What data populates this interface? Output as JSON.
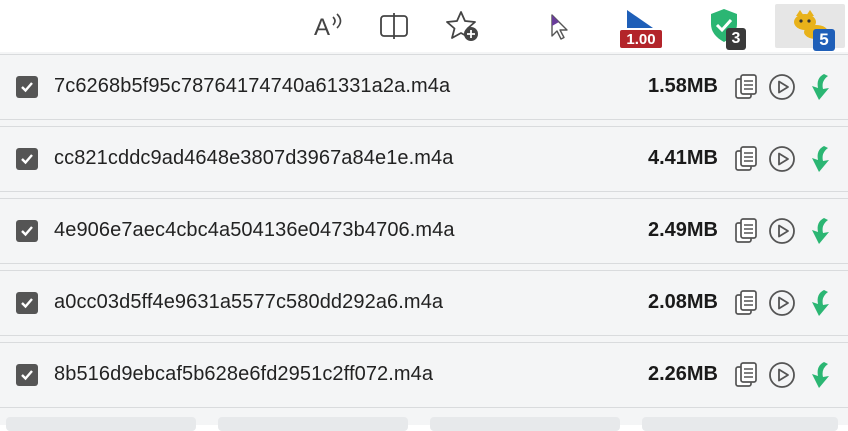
{
  "toolbar": {
    "read_aloud_label": "A",
    "ext_zoom_badge": "1.00",
    "ext_shield_badge": "3",
    "ext_cat_badge": "5"
  },
  "files": [
    {
      "name": "7c6268b5f95c78764174740a61331a2a.m4a",
      "size": "1.58MB",
      "checked": true
    },
    {
      "name": "cc821cddc9ad4648e3807d3967a84e1e.m4a",
      "size": "4.41MB",
      "checked": true
    },
    {
      "name": "4e906e7aec4cbc4a504136e0473b4706.m4a",
      "size": "2.49MB",
      "checked": true
    },
    {
      "name": "a0cc03d5ff4e9631a5577c580dd292a6.m4a",
      "size": "2.08MB",
      "checked": true
    },
    {
      "name": "8b516d9ebcaf5b628e6fd2951c2ff072.m4a",
      "size": "2.26MB",
      "checked": true
    }
  ],
  "colors": {
    "accent_green": "#2bb673",
    "checkbox": "#555555",
    "badge_red": "#b3242a",
    "badge_blue": "#1f5fb8"
  },
  "icons": [
    "read-aloud-icon",
    "split-screen-icon",
    "add-favorite-icon",
    "cursor-extension-icon",
    "zoom-extension-icon",
    "shield-extension-icon",
    "cat-extension-icon",
    "copy-icon",
    "play-icon",
    "download-icon",
    "checkbox-checked-icon"
  ]
}
